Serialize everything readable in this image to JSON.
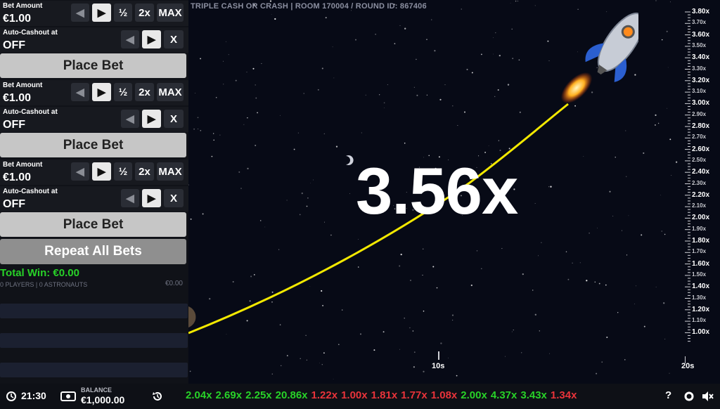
{
  "colors": {
    "win": "#28d228",
    "loss": "#e8333a",
    "curve": "#f2e800",
    "accent": "#ffffff"
  },
  "bets": [
    {
      "bet_label": "Bet Amount",
      "bet_value": "€1.00",
      "half": "½",
      "double": "2x",
      "max": "MAX",
      "cashout_label": "Auto-Cashout at",
      "cashout_value": "OFF",
      "clear": "X",
      "place": "Place Bet"
    },
    {
      "bet_label": "Bet Amount",
      "bet_value": "€1.00",
      "half": "½",
      "double": "2x",
      "max": "MAX",
      "cashout_label": "Auto-Cashout at",
      "cashout_value": "OFF",
      "clear": "X",
      "place": "Place Bet"
    },
    {
      "bet_label": "Bet Amount",
      "bet_value": "€1.00",
      "half": "½",
      "double": "2x",
      "max": "MAX",
      "cashout_label": "Auto-Cashout at",
      "cashout_value": "OFF",
      "clear": "X",
      "place": "Place Bet"
    }
  ],
  "icons": {
    "decrease": "chevron-left-icon",
    "increase": "chevron-right-icon",
    "clock": "clock-icon",
    "balance": "wallet-icon",
    "history": "history-icon",
    "help": "help-icon",
    "settings": "gear-icon",
    "sound": "speaker-mute-icon",
    "rocket": "rocket-icon"
  },
  "repeat_label": "Repeat All Bets",
  "total_win": "Total Win: €0.00",
  "players_text": "0 PLAYERS | 0 ASTRONAUTS",
  "players_amount": "€0.00",
  "game": {
    "title": "TRIPLE CASH OR CRASH  |  ROOM 170004 / ROUND ID: 867406",
    "multiplier": "3.56x",
    "y_axis": [
      "3.80x",
      "3.70x",
      "3.60x",
      "3.50x",
      "3.40x",
      "3.30x",
      "3.20x",
      "3.10x",
      "3.00x",
      "2.90x",
      "2.80x",
      "2.70x",
      "2.60x",
      "2.50x",
      "2.40x",
      "2.30x",
      "2.20x",
      "2.10x",
      "2.00x",
      "1.90x",
      "1.80x",
      "1.70x",
      "1.60x",
      "1.50x",
      "1.40x",
      "1.30x",
      "1.20x",
      "1.10x",
      "1.00x"
    ],
    "x_axis": [
      "10s",
      "20s"
    ]
  },
  "bottom": {
    "time": "21:30",
    "balance_label": "BALANCE",
    "balance_value": "€1,000.00",
    "history": [
      {
        "v": "2.04x",
        "win": true
      },
      {
        "v": "2.69x",
        "win": true
      },
      {
        "v": "2.25x",
        "win": true
      },
      {
        "v": "20.86x",
        "win": true
      },
      {
        "v": "1.22x",
        "win": false
      },
      {
        "v": "1.00x",
        "win": false
      },
      {
        "v": "1.81x",
        "win": false
      },
      {
        "v": "1.77x",
        "win": false
      },
      {
        "v": "1.08x",
        "win": false
      },
      {
        "v": "2.00x",
        "win": true
      },
      {
        "v": "4.37x",
        "win": true
      },
      {
        "v": "3.43x",
        "win": true
      },
      {
        "v": "1.34x",
        "win": false
      }
    ],
    "help": "?"
  }
}
